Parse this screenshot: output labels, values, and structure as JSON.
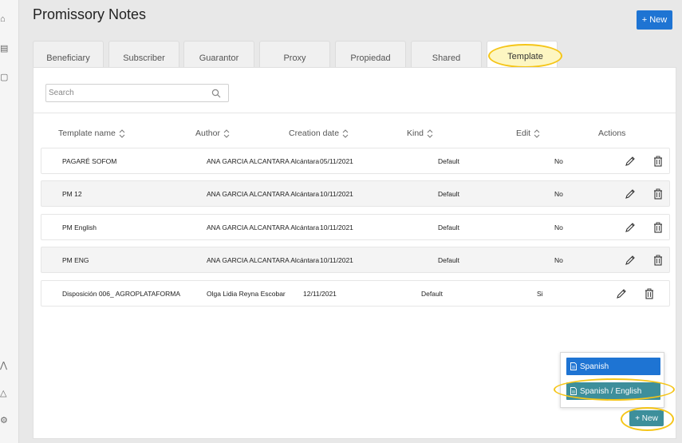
{
  "header": {
    "title": "Promissory Notes",
    "new_button": "+ New"
  },
  "tabs": [
    {
      "label": "Beneficiary"
    },
    {
      "label": "Subscriber"
    },
    {
      "label": "Guarantor"
    },
    {
      "label": "Proxy"
    },
    {
      "label": "Propiedad"
    },
    {
      "label": "Shared"
    },
    {
      "label": "Template",
      "active": true
    }
  ],
  "search": {
    "placeholder": "Search",
    "value": ""
  },
  "table": {
    "columns": [
      "Template name",
      "Author",
      "Creation date",
      "Kind",
      "Edit",
      "Actions"
    ],
    "rows": [
      {
        "name": "PAGARÉ SOFOM",
        "author": "ANA GARCIA ALCANTARA Alcántara",
        "date": "05/11/2021",
        "kind": "Default",
        "edit": "No"
      },
      {
        "name": "PM 12",
        "author": "ANA GARCIA ALCANTARA Alcántara",
        "date": "10/11/2021",
        "kind": "Default",
        "edit": "No"
      },
      {
        "name": "PM English",
        "author": "ANA GARCIA ALCANTARA Alcántara",
        "date": "10/11/2021",
        "kind": "Default",
        "edit": "No"
      },
      {
        "name": "PM ENG",
        "author": "ANA GARCIA ALCANTARA Alcántara",
        "date": "10/11/2021",
        "kind": "Default",
        "edit": "No"
      },
      {
        "name": "Disposición 006_ AGROPLATAFORMA",
        "author": "Olga Lidia Reyna Escobar",
        "date": "12/11/2021",
        "kind": "Default",
        "edit": "Si"
      }
    ]
  },
  "new_menu": {
    "items": [
      "Spanish",
      "Spanish / English"
    ],
    "button": "+ New"
  },
  "colors": {
    "primary": "#1e74d3",
    "teal": "#3d8f9b",
    "highlight": "#f5c518"
  },
  "icons": [
    "home-icon",
    "grid-icon",
    "square-icon",
    "chart-icon",
    "triangle-icon",
    "gear-icon",
    "search-icon",
    "sort-icon",
    "pencil-icon",
    "trash-icon",
    "document-icon"
  ]
}
